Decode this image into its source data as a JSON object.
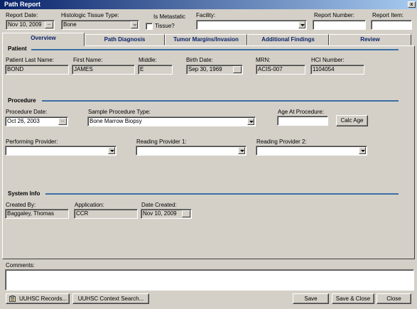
{
  "window": {
    "title": "Path Report",
    "close_glyph": "x"
  },
  "header": {
    "report_date_label": "Report Date:",
    "report_date_value": "Nov 10, 2009",
    "tissue_type_label": "Histologic Tissue Type:",
    "tissue_type_value": "Bone",
    "metastatic_label_1": "Is Metastatic",
    "metastatic_label_2": "Tissue?",
    "facility_label": "Facility:",
    "facility_value": "",
    "report_number_label": "Report Number:",
    "report_number_value": "",
    "report_item_label": "Report Item:",
    "report_item_value": ""
  },
  "tabs": [
    {
      "label": "Overview",
      "active": true
    },
    {
      "label": "Path Diagnosis"
    },
    {
      "label": "Tumor Margins/Invasion"
    },
    {
      "label": "Additional Findings"
    },
    {
      "label": "Review"
    }
  ],
  "patient": {
    "section_title": "Patient",
    "last_name_label": "Patient Last Name:",
    "last_name_value": "BOND",
    "first_name_label": "First Name:",
    "first_name_value": "JAMES",
    "middle_label": "Middle:",
    "middle_value": "E",
    "birth_date_label": "Birth Date:",
    "birth_date_value": "Sep 30, 1969",
    "mrn_label": "MRN:",
    "mrn_value": "ACIS-007",
    "hci_label": "HCI Number:",
    "hci_value": "1104054"
  },
  "procedure": {
    "section_title": "Procedure",
    "date_label": "Procedure Date:",
    "date_value": "Oct 26, 2003",
    "type_label": "Sample Procedure Type:",
    "type_value": "Bone Marrow Biopsy",
    "age_label": "Age At Procedure:",
    "age_value": "",
    "calc_age_label": "Calc Age",
    "performing_label": "Performing Provider:",
    "performing_value": "",
    "reading1_label": "Reading Provider 1:",
    "reading1_value": "",
    "reading2_label": "Reading Provider 2:",
    "reading2_value": ""
  },
  "system": {
    "section_title": "System Info",
    "created_by_label": "Created By:",
    "created_by_value": "Baggaley, Thomas",
    "application_label": "Application:",
    "application_value": "CCR",
    "date_created_label": "Date Created:",
    "date_created_value": "Nov 10, 2009"
  },
  "comments": {
    "label": "Comments:",
    "value": ""
  },
  "footer": {
    "records_label": "UUHSC Records...",
    "context_search_label": "UUHSC Context Search...",
    "save_label": "Save",
    "save_close_label": "Save & Close",
    "close_label": "Close"
  },
  "glyphs": {
    "ellipsis": "..."
  },
  "colors": {
    "title_bar": "#0a246a",
    "tab_text": "#0a246a",
    "section_line": "#3a6ea5",
    "background": "#d4d0c8"
  }
}
